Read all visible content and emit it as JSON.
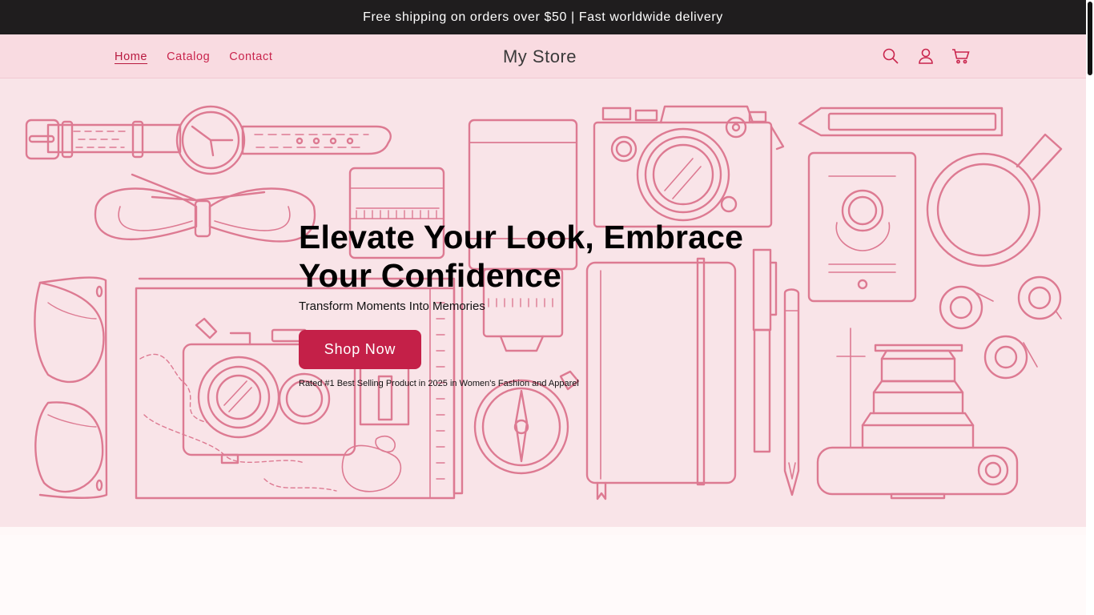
{
  "announcement": "Free shipping on orders over $50 | Fast worldwide delivery",
  "header": {
    "nav": [
      "Home",
      "Catalog",
      "Contact"
    ],
    "store_name": "My Store",
    "icons": [
      "search-icon",
      "account-icon",
      "cart-icon"
    ]
  },
  "hero": {
    "title": "Elevate Your Look, Embrace Your Confidence",
    "subtitle": "Transform Moments Into Memories",
    "button_label": "Shop Now",
    "note": "Rated #1 Best Selling Product in 2025 in Women's Fashion and Apparel"
  },
  "colors": {
    "announcement_bg": "#1f1d1e",
    "header_bg": "#f9dbe1",
    "hero_bg": "#f9e4e8",
    "accent": "#c42048",
    "line_art": "#dd7a92"
  }
}
